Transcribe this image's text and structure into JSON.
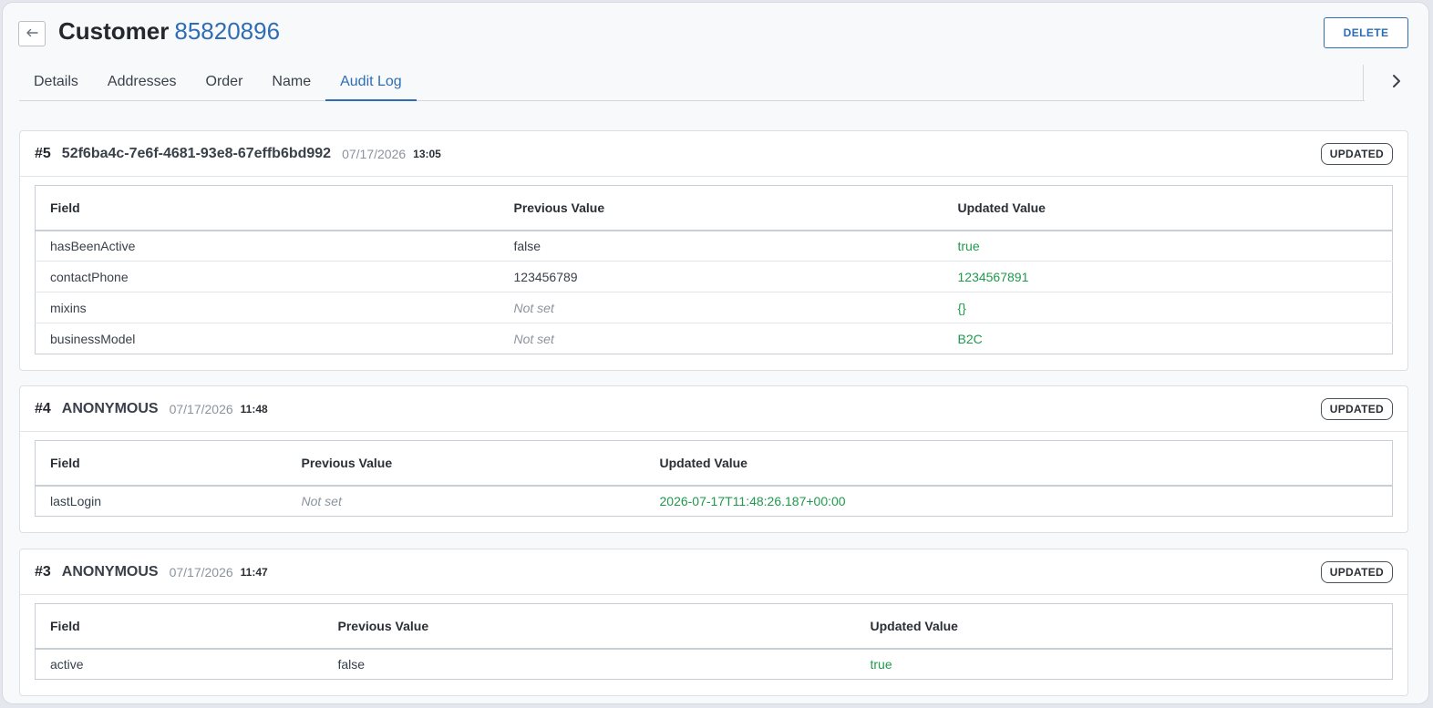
{
  "header": {
    "title": "Customer",
    "customer_id": "85820896",
    "delete_label": "DELETE"
  },
  "tabs": [
    {
      "label": "Details"
    },
    {
      "label": "Addresses"
    },
    {
      "label": "Order"
    },
    {
      "label": "Name"
    },
    {
      "label": "Audit Log"
    }
  ],
  "active_tab": "Audit Log",
  "columns": {
    "field": "Field",
    "previous": "Previous Value",
    "updated": "Updated Value"
  },
  "entries": [
    {
      "num": "#5",
      "user": "52f6ba4c-7e6f-4681-93e8-67effb6bd992",
      "date": "07/17/2026",
      "time": "13:05",
      "badge": "UPDATED",
      "rows": [
        {
          "field": "hasBeenActive",
          "previous": "false",
          "updated": "true"
        },
        {
          "field": "contactPhone",
          "previous": "123456789",
          "updated": "1234567891"
        },
        {
          "field": "mixins",
          "previous": "Not set",
          "updated": "{}"
        },
        {
          "field": "businessModel",
          "previous": "Not set",
          "updated": "B2C"
        }
      ]
    },
    {
      "num": "#4",
      "user": "ANONYMOUS",
      "date": "07/17/2026",
      "time": "11:48",
      "badge": "UPDATED",
      "rows": [
        {
          "field": "lastLogin",
          "previous": "Not set",
          "updated": "2026-07-17T11:48:26.187+00:00"
        }
      ]
    },
    {
      "num": "#3",
      "user": "ANONYMOUS",
      "date": "07/17/2026",
      "time": "11:47",
      "badge": "UPDATED",
      "rows": [
        {
          "field": "active",
          "previous": "false",
          "updated": "true"
        }
      ]
    }
  ],
  "colors": {
    "accent": "#2e6db5",
    "updated_value": "#1f9a4c",
    "muted": "#8b939d"
  },
  "icons": {
    "back": "arrow-left-icon",
    "next": "chevron-right-icon"
  }
}
